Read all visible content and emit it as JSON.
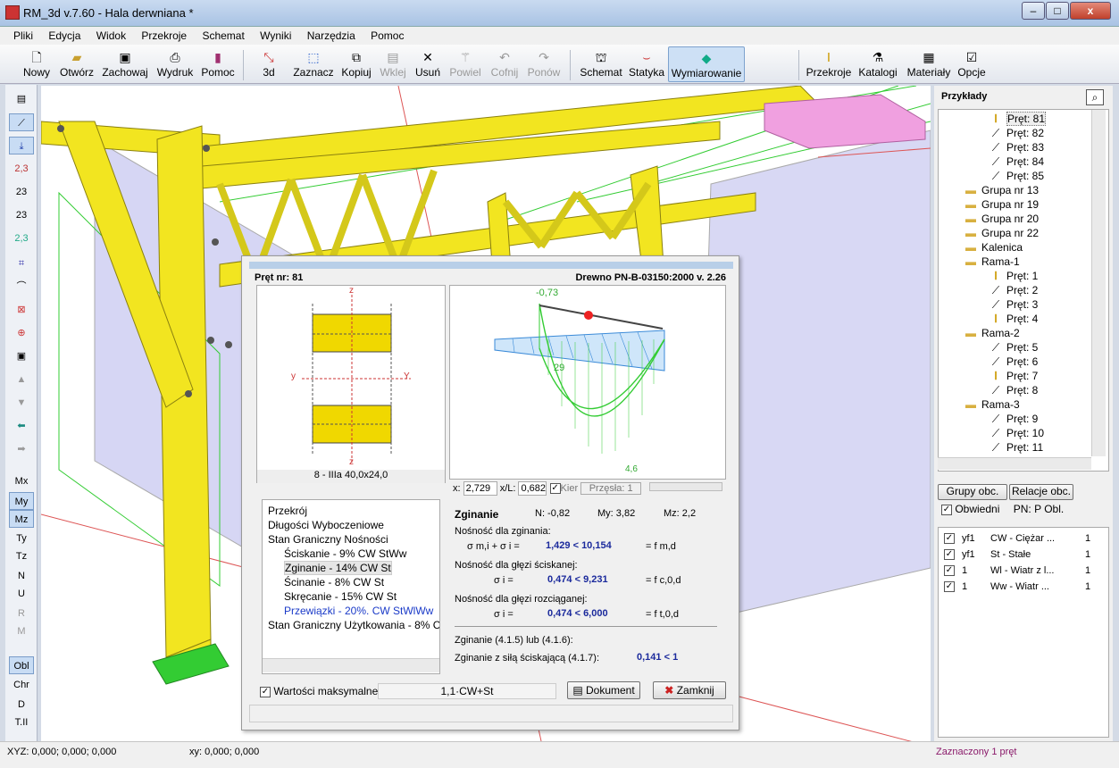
{
  "window": {
    "title": "RM_3d v.7.60 - Hala derwniana *",
    "min": "–",
    "max": "□",
    "close": "x"
  },
  "menu": [
    "Pliki",
    "Edycja",
    "Widok",
    "Przekroje",
    "Schemat",
    "Wyniki",
    "Narzędzia",
    "Pomoc"
  ],
  "toolbar": {
    "nowy": "Nowy",
    "otworz": "Otwórz",
    "zachowaj": "Zachowaj",
    "wydruk": "Wydruk",
    "pomoc": "Pomoc",
    "d3": "3d",
    "zaznacz": "Zaznacz",
    "kopiuj": "Kopiuj",
    "wklej": "Wklej",
    "usun": "Usuń",
    "powiel": "Powiel",
    "cofnij": "Cofnij",
    "ponow": "Ponów",
    "schemat": "Schemat",
    "statyka": "Statyka",
    "wymiarowanie": "Wymiarowanie",
    "przekroje": "Przekroje",
    "katalogi": "Katalogi",
    "materialy": "Materiały",
    "opcje": "Opcje"
  },
  "left_toolbar": [
    "2,3",
    "23",
    "23",
    "2,3",
    "Mx",
    "My",
    "Mz",
    "Ty",
    "Tz",
    "N",
    "U",
    "R",
    "M",
    "Obl",
    "Chr",
    "D",
    "T.II"
  ],
  "right_panel": {
    "title": "Przykłady",
    "tree": [
      {
        "label": "Pręt: 81",
        "level": 3,
        "icon": "beam"
      },
      {
        "label": "Pręt: 82",
        "level": 3,
        "icon": "line"
      },
      {
        "label": "Pręt: 83",
        "level": 3,
        "icon": "line"
      },
      {
        "label": "Pręt: 84",
        "level": 3,
        "icon": "line"
      },
      {
        "label": "Pręt: 85",
        "level": 3,
        "icon": "line"
      },
      {
        "label": "Grupa nr 13",
        "level": 1,
        "icon": "folder"
      },
      {
        "label": "Grupa nr 19",
        "level": 1,
        "icon": "folder"
      },
      {
        "label": "Grupa nr 20",
        "level": 1,
        "icon": "folder"
      },
      {
        "label": "Grupa nr 22",
        "level": 1,
        "icon": "folder"
      },
      {
        "label": "Kalenica",
        "level": 1,
        "icon": "folder"
      },
      {
        "label": "Rama-1",
        "level": 1,
        "icon": "folder"
      },
      {
        "label": "Pręt: 1",
        "level": 3,
        "icon": "beam"
      },
      {
        "label": "Pręt: 2",
        "level": 3,
        "icon": "line"
      },
      {
        "label": "Pręt: 3",
        "level": 3,
        "icon": "line"
      },
      {
        "label": "Pręt: 4",
        "level": 3,
        "icon": "beam"
      },
      {
        "label": "Rama-2",
        "level": 1,
        "icon": "folder"
      },
      {
        "label": "Pręt: 5",
        "level": 3,
        "icon": "line"
      },
      {
        "label": "Pręt: 6",
        "level": 3,
        "icon": "line"
      },
      {
        "label": "Pręt: 7",
        "level": 3,
        "icon": "beam"
      },
      {
        "label": "Pręt: 8",
        "level": 3,
        "icon": "line"
      },
      {
        "label": "Rama-3",
        "level": 1,
        "icon": "folder"
      },
      {
        "label": "Pręt: 9",
        "level": 3,
        "icon": "line"
      },
      {
        "label": "Pręt: 10",
        "level": 3,
        "icon": "line"
      },
      {
        "label": "Pręt: 11",
        "level": 3,
        "icon": "line"
      }
    ],
    "grupy_btn": "Grupy obc.",
    "relacje_btn": "Relacje obc.",
    "obwiedni": "Obwiedni",
    "pn": "PN:",
    "pn_val": "P Obl.",
    "loads": [
      {
        "a": "yf1",
        "b": "CW - Ciężar ...",
        "c": "1"
      },
      {
        "a": "yf1",
        "b": "St - Stałe",
        "c": "1"
      },
      {
        "a": "1",
        "b": "Wl - Wiatr z l...",
        "c": "1"
      },
      {
        "a": "1",
        "b": "Ww - Wiatr ...",
        "c": "1"
      }
    ]
  },
  "status": {
    "xyz": "XYZ: 0,000; 0,000; 0,000",
    "xy": "xy: 0,000; 0,000",
    "sel": "Zaznaczony 1 pręt"
  },
  "dialog": {
    "pret": "Pręt nr:  81",
    "norm": "Drewno PN-B-03150:2000 v. 2.26",
    "section_caption": "8 - IIIa 40,0x24,0",
    "axis_z": "z",
    "axis_y": "y",
    "axis_Y": "Y",
    "axis_z2": "z",
    "chart_labels": {
      "a": "-0,73",
      "b": "29",
      "c": "4,6"
    },
    "x_label": "x:",
    "x_val": "2,729",
    "xl_label": "x/L:",
    "xl_val": "0,682",
    "kier": "Kier",
    "przesla": "Przęsła: 1",
    "tree": [
      {
        "label": "Przekrój",
        "level": 0
      },
      {
        "label": "Długości Wyboczeniowe",
        "level": 0
      },
      {
        "label": "Stan Graniczny Nośności",
        "level": 0
      },
      {
        "label": "Ściskanie - 9%   CW StWw",
        "level": 1
      },
      {
        "label": "Zginanie - 14%   CW St",
        "level": 1,
        "sel": true
      },
      {
        "label": "Ścinanie - 8%   CW St",
        "level": 1
      },
      {
        "label": "Skręcanie - 15%   CW St",
        "level": 1
      },
      {
        "label": "Przewiązki - 20%.   CW StWlWw",
        "level": 1,
        "blue": true
      },
      {
        "label": "Stan Graniczny Użytkowania - 8%   C",
        "level": 0
      }
    ],
    "results": {
      "title": "Zginanie",
      "n": "N:  -0,82",
      "my": "My: 3,82",
      "mz": "Mz:  2,2",
      "l1": "Nośność dla zginania:",
      "f1a": "σ m,i + σ i =",
      "v1": "1,429 < 10,154",
      "f1b": "= f m,d",
      "l2": "Nośność dla głęzi ściskanej:",
      "f2a": "σ i =",
      "v2": "0,474 < 9,231",
      "f2b": "= f c,0,d",
      "l3": "Nośność dla głęzi rozciąganej:",
      "f3a": "σ i =",
      "v3": "0,474 < 6,000",
      "f3b": "= f t,0,d",
      "l4": "Zginanie (4.1.5) lub (4.1.6):",
      "l5": "Zginanie z siłą ściskającą (4.1.7):",
      "v5": "0,141 < 1"
    },
    "max_label": "Wartości maksymalne",
    "combo": "1,1·CW+St",
    "dokument": "Dokument",
    "zamknij": "Zamknij"
  }
}
